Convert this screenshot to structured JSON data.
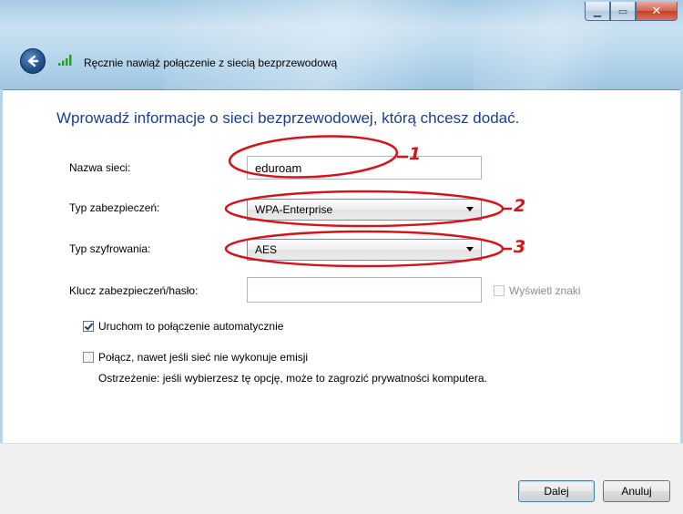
{
  "window": {
    "title": "Ręcznie nawiąż połączenie z siecią bezprzewodową",
    "caption_buttons": [
      "minimize",
      "maximize",
      "close"
    ]
  },
  "heading": "Wprowadź informacje o sieci bezprzewodowej, którą chcesz dodać.",
  "form": {
    "network_name_label": "Nazwa sieci:",
    "network_name_value": "eduroam",
    "security_type_label": "Typ zabezpieczeń:",
    "security_type_value": "WPA-Enterprise",
    "encryption_type_label": "Typ szyfrowania:",
    "encryption_type_value": "AES",
    "security_key_label": "Klucz zabezpieczeń/hasło:",
    "security_key_value": "",
    "show_chars_label": "Wyświetl znaki",
    "auto_connect_label": "Uruchom to połączenie automatycznie",
    "auto_connect_checked": true,
    "connect_hidden_label": "Połącz, nawet jeśli sieć nie wykonuje emisji",
    "connect_hidden_checked": false,
    "warning": "Ostrzeżenie: jeśli wybierzesz tę opcję, może to zagrozić prywatności komputera."
  },
  "annotations": [
    "1",
    "2",
    "3"
  ],
  "footer": {
    "next_label": "Dalej",
    "cancel_label": "Anuluj"
  },
  "colors": {
    "heading": "#1a3f8f",
    "annotation": "#d4141a"
  },
  "icons": [
    "back-arrow-icon",
    "wireless-signal-icon",
    "minimize-icon",
    "maximize-icon",
    "close-icon"
  ]
}
